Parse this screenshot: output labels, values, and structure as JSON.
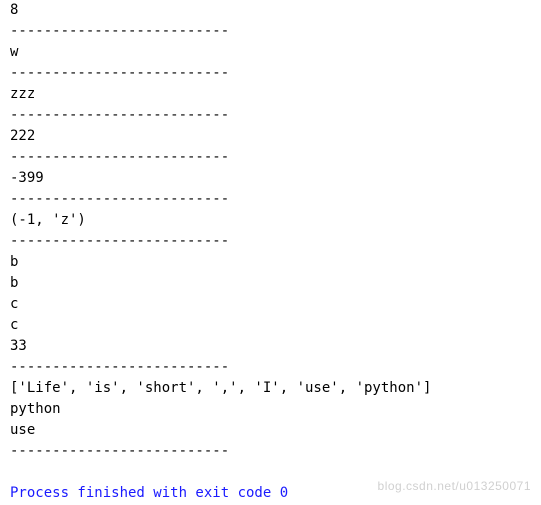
{
  "output": {
    "lines": [
      "8",
      "--------------------------",
      "w",
      "--------------------------",
      "zzz",
      "--------------------------",
      "222",
      "--------------------------",
      "-399",
      "--------------------------",
      "(-1, 'z')",
      "--------------------------",
      "b",
      "b",
      "c",
      "c",
      "33",
      "--------------------------",
      "['Life', 'is', 'short', ',', 'I', 'use', 'python']",
      "python",
      "use",
      "--------------------------"
    ],
    "exit_message": "Process finished with exit code 0"
  },
  "watermark": "blog.csdn.net/u013250071"
}
